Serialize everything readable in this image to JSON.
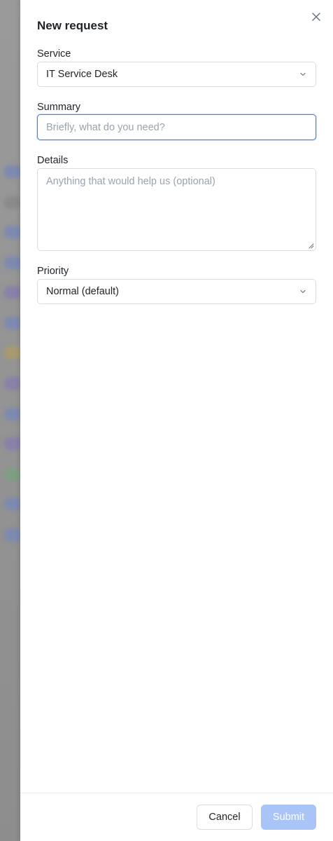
{
  "dialog": {
    "title": "New request",
    "close_icon": "close-icon"
  },
  "form": {
    "service": {
      "label": "Service",
      "value": "IT Service Desk"
    },
    "summary": {
      "label": "Summary",
      "placeholder": "Briefly, what do you need?",
      "value": ""
    },
    "details": {
      "label": "Details",
      "placeholder": "Anything that would help us (optional)",
      "value": ""
    },
    "priority": {
      "label": "Priority",
      "value": "Normal (default)"
    }
  },
  "footer": {
    "cancel_label": "Cancel",
    "submit_label": "Submit"
  },
  "colors": {
    "accent": "#3b82f6",
    "submit_disabled": "#a9c4f6"
  }
}
